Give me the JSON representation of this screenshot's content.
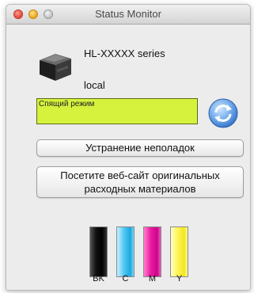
{
  "window": {
    "title": "Status Monitor"
  },
  "printer": {
    "model": "HL-XXXXX series",
    "connection": "local",
    "status": "Спящий режим",
    "status_color": "#d6f23c",
    "icon": "printer-icon"
  },
  "buttons": {
    "troubleshoot": "Устранение неполадок",
    "supplies_line1": "Посетите веб-сайт оригинальных",
    "supplies_line2": "расходных материалов"
  },
  "ink": [
    {
      "label": "BK",
      "color": "#000000"
    },
    {
      "label": "C",
      "color": "#1aa8de"
    },
    {
      "label": "M",
      "color": "#ec1aa0"
    },
    {
      "label": "Y",
      "color": "#fff45a"
    }
  ]
}
